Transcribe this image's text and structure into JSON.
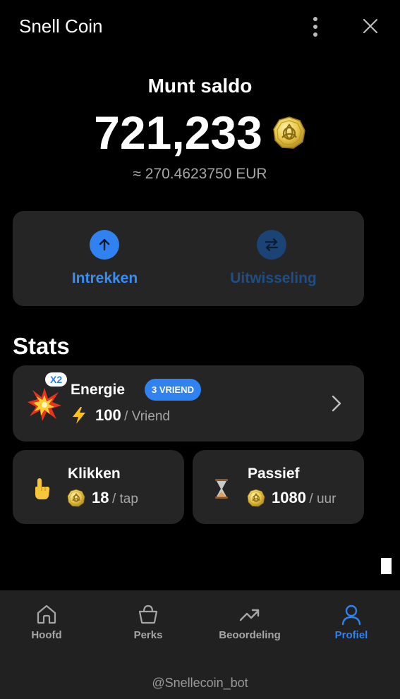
{
  "header": {
    "title": "Snell Coin",
    "menu_icon": "kebab-menu-icon",
    "close_icon": "close-icon"
  },
  "balance": {
    "label": "Munt saldo",
    "value": "721,233",
    "coin_icon": "coin-icon",
    "fiat": "≈ 270.4623750 EUR"
  },
  "actions": [
    {
      "label": "Intrekken",
      "icon": "arrow-up-icon",
      "color": "#2f82ef"
    },
    {
      "label": "Uitwisseling",
      "icon": "swap-icon",
      "color": "#1b4375"
    }
  ],
  "stats": {
    "title": "Stats",
    "energy": {
      "badge_multiplier": "X2",
      "title": "Energie",
      "badge": "3 VRIEND",
      "value": "100",
      "unit": "/ Vriend",
      "icon": "explosion-icon",
      "value_icon": "lightning-icon"
    },
    "click": {
      "title": "Klikken",
      "value": "18",
      "unit": "/ tap",
      "icon": "pointing-hand-icon"
    },
    "passive": {
      "title": "Passief",
      "value": "1080",
      "unit": "/ uur",
      "icon": "hourglass-icon"
    }
  },
  "nav": {
    "items": [
      {
        "label": "Hoofd",
        "icon": "home-icon"
      },
      {
        "label": "Perks",
        "icon": "shopping-bag-icon"
      },
      {
        "label": "Beoordeling",
        "icon": "trending-up-icon"
      },
      {
        "label": "Profiel",
        "icon": "user-icon",
        "active": true
      }
    ],
    "handle": "@Snellecoin_bot"
  },
  "colors": {
    "accent": "#2f82ef",
    "background": "#000000",
    "card": "#252526"
  }
}
